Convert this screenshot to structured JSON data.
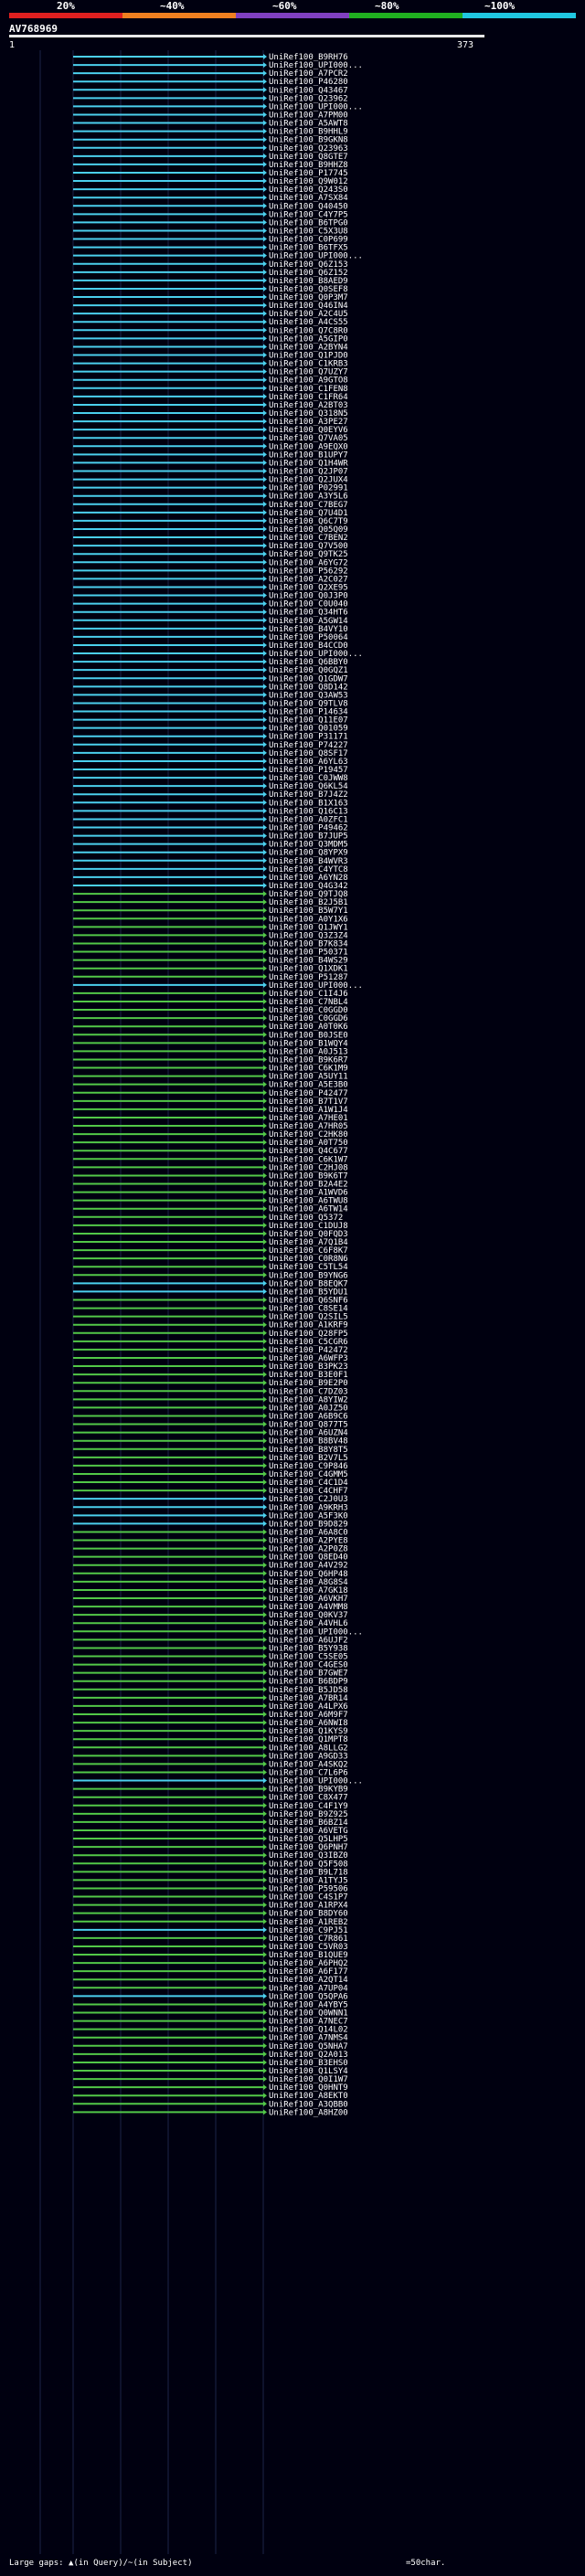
{
  "header": {
    "title": "AV768969",
    "scale_ticks": [
      "20%",
      "~40%",
      "~60%",
      "~80%",
      "~100%"
    ],
    "scale_colors": [
      "#e02020",
      "#f08020",
      "#8040c0",
      "#20b020",
      "#20c8e0"
    ],
    "query_start": "1",
    "query_end": "373"
  },
  "legend": {
    "large_gaps": "Large gaps: ▲(in Query)/~(in Subject)",
    "scale_note": "=50char."
  },
  "colors": {
    "cyan": "#4bd0ee",
    "green": "#52c848",
    "background": "#000010"
  },
  "hits": [
    {
      "label": "UniRef100_B9RH76",
      "color": "cyan"
    },
    {
      "label": "UniRef100_UPI000...",
      "color": "cyan"
    },
    {
      "label": "UniRef100_A7PCR2",
      "color": "cyan"
    },
    {
      "label": "UniRef100_P46280",
      "color": "cyan"
    },
    {
      "label": "UniRef100_Q43467",
      "color": "cyan"
    },
    {
      "label": "UniRef100_Q23962",
      "color": "cyan"
    },
    {
      "label": "UniRef100_UPI000...",
      "color": "cyan"
    },
    {
      "label": "UniRef100_A7PM00",
      "color": "cyan"
    },
    {
      "label": "UniRef100_A5AWT8",
      "color": "cyan"
    },
    {
      "label": "UniRef100_B9HHL9",
      "color": "cyan"
    },
    {
      "label": "UniRef100_B9GKN8",
      "color": "cyan"
    },
    {
      "label": "UniRef100_Q23963",
      "color": "cyan"
    },
    {
      "label": "UniRef100_Q8GTE7",
      "color": "cyan"
    },
    {
      "label": "UniRef100_B9HHZ8",
      "color": "cyan"
    },
    {
      "label": "UniRef100_P17745",
      "color": "cyan"
    },
    {
      "label": "UniRef100_Q9W012",
      "color": "cyan"
    },
    {
      "label": "UniRef100_Q243S0",
      "color": "cyan"
    },
    {
      "label": "UniRef100_A7SX84",
      "color": "cyan"
    },
    {
      "label": "UniRef100_Q40450",
      "color": "cyan"
    },
    {
      "label": "UniRef100_C4Y7P5",
      "color": "cyan"
    },
    {
      "label": "UniRef100_B6TPG0",
      "color": "cyan"
    },
    {
      "label": "UniRef100_C5X3U8",
      "color": "cyan"
    },
    {
      "label": "UniRef100_C0P699",
      "color": "cyan"
    },
    {
      "label": "UniRef100_B6TFX5",
      "color": "cyan"
    },
    {
      "label": "UniRef100_UPI000...",
      "color": "cyan"
    },
    {
      "label": "UniRef100_Q6Z153",
      "color": "cyan"
    },
    {
      "label": "UniRef100_Q6Z152",
      "color": "cyan"
    },
    {
      "label": "UniRef100_B8AED9",
      "color": "cyan"
    },
    {
      "label": "UniRef100_Q0SEF8",
      "color": "cyan"
    },
    {
      "label": "UniRef100_Q0P3M7",
      "color": "cyan"
    },
    {
      "label": "UniRef100_Q46IN4",
      "color": "cyan"
    },
    {
      "label": "UniRef100_A2C4U5",
      "color": "cyan"
    },
    {
      "label": "UniRef100_A4CS55",
      "color": "cyan"
    },
    {
      "label": "UniRef100_Q7C8R0",
      "color": "cyan"
    },
    {
      "label": "UniRef100_A5GIP0",
      "color": "cyan"
    },
    {
      "label": "UniRef100_A2BYN4",
      "color": "cyan"
    },
    {
      "label": "UniRef100_Q1PJD0",
      "color": "cyan"
    },
    {
      "label": "UniRef100_C1KRB3",
      "color": "cyan"
    },
    {
      "label": "UniRef100_Q7UZY7",
      "color": "cyan"
    },
    {
      "label": "UniRef100_A9GTO8",
      "color": "cyan"
    },
    {
      "label": "UniRef100_C1FEN8",
      "color": "cyan"
    },
    {
      "label": "UniRef100_C1FR64",
      "color": "cyan"
    },
    {
      "label": "UniRef100_A2BT03",
      "color": "cyan"
    },
    {
      "label": "UniRef100_Q318N5",
      "color": "cyan"
    },
    {
      "label": "UniRef100_A3PE27",
      "color": "cyan"
    },
    {
      "label": "UniRef100_Q0EYV6",
      "color": "cyan"
    },
    {
      "label": "UniRef100_Q7VA05",
      "color": "cyan"
    },
    {
      "label": "UniRef100_A9EQX0",
      "color": "cyan"
    },
    {
      "label": "UniRef100_B1UPY7",
      "color": "cyan"
    },
    {
      "label": "UniRef100_Q1H4WR",
      "color": "cyan"
    },
    {
      "label": "UniRef100_Q2JP07",
      "color": "cyan"
    },
    {
      "label": "UniRef100_Q2JUX4",
      "color": "cyan"
    },
    {
      "label": "UniRef100_P02991",
      "color": "cyan"
    },
    {
      "label": "UniRef100_A3Y5L6",
      "color": "cyan"
    },
    {
      "label": "UniRef100_C7BEG7",
      "color": "cyan"
    },
    {
      "label": "UniRef100_Q7U4D1",
      "color": "cyan"
    },
    {
      "label": "UniRef100_Q6C7T9",
      "color": "cyan"
    },
    {
      "label": "UniRef100_Q05Q09",
      "color": "cyan"
    },
    {
      "label": "UniRef100_C7BEN2",
      "color": "cyan"
    },
    {
      "label": "UniRef100_Q7V500",
      "color": "cyan"
    },
    {
      "label": "UniRef100_Q9TK25",
      "color": "cyan"
    },
    {
      "label": "UniRef100_A6YG72",
      "color": "cyan"
    },
    {
      "label": "UniRef100_P56292",
      "color": "cyan"
    },
    {
      "label": "UniRef100_A2C027",
      "color": "cyan"
    },
    {
      "label": "UniRef100_Q2XE95",
      "color": "cyan"
    },
    {
      "label": "UniRef100_Q0J3P0",
      "color": "cyan"
    },
    {
      "label": "UniRef100_C0U040",
      "color": "cyan"
    },
    {
      "label": "UniRef100_Q34HT6",
      "color": "cyan"
    },
    {
      "label": "UniRef100_A5GW14",
      "color": "cyan"
    },
    {
      "label": "UniRef100_B4VY10",
      "color": "cyan"
    },
    {
      "label": "UniRef100_P50064",
      "color": "cyan"
    },
    {
      "label": "UniRef100_B4CCD0",
      "color": "cyan"
    },
    {
      "label": "UniRef100_UPI000...",
      "color": "cyan"
    },
    {
      "label": "UniRef100_Q6BBY0",
      "color": "cyan"
    },
    {
      "label": "UniRef100_Q0GQZ1",
      "color": "cyan"
    },
    {
      "label": "UniRef100_Q1GDW7",
      "color": "cyan"
    },
    {
      "label": "UniRef100_Q8D142",
      "color": "cyan"
    },
    {
      "label": "UniRef100_Q3AW53",
      "color": "cyan"
    },
    {
      "label": "UniRef100_Q9TLV8",
      "color": "cyan"
    },
    {
      "label": "UniRef100_P14634",
      "color": "cyan"
    },
    {
      "label": "UniRef100_Q11E07",
      "color": "cyan"
    },
    {
      "label": "UniRef100_Q01059",
      "color": "cyan"
    },
    {
      "label": "UniRef100_P31171",
      "color": "cyan"
    },
    {
      "label": "UniRef100_P74227",
      "color": "cyan"
    },
    {
      "label": "UniRef100_Q8SF17",
      "color": "cyan"
    },
    {
      "label": "UniRef100_A6YL63",
      "color": "cyan"
    },
    {
      "label": "UniRef100_P19457",
      "color": "cyan"
    },
    {
      "label": "UniRef100_C0JWW8",
      "color": "cyan"
    },
    {
      "label": "UniRef100_Q6KL54",
      "color": "cyan"
    },
    {
      "label": "UniRef100_B7J4Z2",
      "color": "cyan"
    },
    {
      "label": "UniRef100_B1X163",
      "color": "cyan"
    },
    {
      "label": "UniRef100_Q16C13",
      "color": "cyan"
    },
    {
      "label": "UniRef100_A0ZFC1",
      "color": "cyan"
    },
    {
      "label": "UniRef100_P49462",
      "color": "cyan"
    },
    {
      "label": "UniRef100_B7JUP5",
      "color": "cyan"
    },
    {
      "label": "UniRef100_Q3MDM5",
      "color": "cyan"
    },
    {
      "label": "UniRef100_Q8YPX9",
      "color": "cyan"
    },
    {
      "label": "UniRef100_B4WVR3",
      "color": "cyan"
    },
    {
      "label": "UniRef100_C4YTC8",
      "color": "cyan"
    },
    {
      "label": "UniRef100_A6YN28",
      "color": "cyan"
    },
    {
      "label": "UniRef100_Q4G342",
      "color": "cyan"
    },
    {
      "label": "UniRef100_Q9TJQ8",
      "color": "green"
    },
    {
      "label": "UniRef100_B2J5B1",
      "color": "green"
    },
    {
      "label": "UniRef100_B5W7Y1",
      "color": "green"
    },
    {
      "label": "UniRef100_A0Y1X6",
      "color": "green"
    },
    {
      "label": "UniRef100_Q1JWY1",
      "color": "green"
    },
    {
      "label": "UniRef100_Q3Z3Z4",
      "color": "green"
    },
    {
      "label": "UniRef100_B7K834",
      "color": "green"
    },
    {
      "label": "UniRef100_P50371",
      "color": "green"
    },
    {
      "label": "UniRef100_B4WS29",
      "color": "green"
    },
    {
      "label": "UniRef100_Q1XDK1",
      "color": "green"
    },
    {
      "label": "UniRef100_P51287",
      "color": "green"
    },
    {
      "label": "UniRef100_UPI000...",
      "color": "cyan"
    },
    {
      "label": "UniRef100_C1I4J6",
      "color": "green"
    },
    {
      "label": "UniRef100_C7NBL4",
      "color": "green"
    },
    {
      "label": "UniRef100_C0GGD0",
      "color": "green"
    },
    {
      "label": "UniRef100_C0GGD6",
      "color": "green"
    },
    {
      "label": "UniRef100_A0T0K6",
      "color": "green"
    },
    {
      "label": "UniRef100_B0JSE0",
      "color": "green"
    },
    {
      "label": "UniRef100_B1WQY4",
      "color": "green"
    },
    {
      "label": "UniRef100_A0J513",
      "color": "green"
    },
    {
      "label": "UniRef100_B9K6R7",
      "color": "green"
    },
    {
      "label": "UniRef100_C6K1M9",
      "color": "green"
    },
    {
      "label": "UniRef100_A5UY11",
      "color": "green"
    },
    {
      "label": "UniRef100_A5E3B0",
      "color": "green"
    },
    {
      "label": "UniRef100_P42477",
      "color": "green"
    },
    {
      "label": "UniRef100_B7T1V7",
      "color": "green"
    },
    {
      "label": "UniRef100_A1W1J4",
      "color": "green"
    },
    {
      "label": "UniRef100_A7HE01",
      "color": "green"
    },
    {
      "label": "UniRef100_A7HR05",
      "color": "green"
    },
    {
      "label": "UniRef100_C2HK80",
      "color": "green"
    },
    {
      "label": "UniRef100_A0T750",
      "color": "green"
    },
    {
      "label": "UniRef100_Q4C677",
      "color": "green"
    },
    {
      "label": "UniRef100_C6K1W7",
      "color": "green"
    },
    {
      "label": "UniRef100_C2HJ08",
      "color": "green"
    },
    {
      "label": "UniRef100_B9K6T7",
      "color": "green"
    },
    {
      "label": "UniRef100_B2A4E2",
      "color": "green"
    },
    {
      "label": "UniRef100_A1WVD6",
      "color": "green"
    },
    {
      "label": "UniRef100_A6TWU8",
      "color": "green"
    },
    {
      "label": "UniRef100_A6TW14",
      "color": "green"
    },
    {
      "label": "UniRef100_Q5372",
      "color": "green"
    },
    {
      "label": "UniRef100_C1DUJ8",
      "color": "green"
    },
    {
      "label": "UniRef100_Q0FQD3",
      "color": "green"
    },
    {
      "label": "UniRef100_A7Q1B4",
      "color": "green"
    },
    {
      "label": "UniRef100_C6F8K7",
      "color": "green"
    },
    {
      "label": "UniRef100_C0R8N6",
      "color": "green"
    },
    {
      "label": "UniRef100_C5TL54",
      "color": "green"
    },
    {
      "label": "UniRef100_B9YNG6",
      "color": "green"
    },
    {
      "label": "UniRef100_B8EQK7",
      "color": "cyan"
    },
    {
      "label": "UniRef100_B5YDU1",
      "color": "cyan"
    },
    {
      "label": "UniRef100_Q6SNF6",
      "color": "green"
    },
    {
      "label": "UniRef100_C8SE14",
      "color": "green"
    },
    {
      "label": "UniRef100_Q2SIL5",
      "color": "green"
    },
    {
      "label": "UniRef100_A1KRF9",
      "color": "green"
    },
    {
      "label": "UniRef100_Q28FP5",
      "color": "green"
    },
    {
      "label": "UniRef100_C5CGR6",
      "color": "green"
    },
    {
      "label": "UniRef100_P42472",
      "color": "green"
    },
    {
      "label": "UniRef100_A6WFP3",
      "color": "green"
    },
    {
      "label": "UniRef100_B3PK23",
      "color": "green"
    },
    {
      "label": "UniRef100_B3E0F1",
      "color": "green"
    },
    {
      "label": "UniRef100_B9E2P0",
      "color": "green"
    },
    {
      "label": "UniRef100_C7DZ03",
      "color": "green"
    },
    {
      "label": "UniRef100_A8YIW2",
      "color": "green"
    },
    {
      "label": "UniRef100_A0JZ50",
      "color": "green"
    },
    {
      "label": "UniRef100_A6B9C6",
      "color": "green"
    },
    {
      "label": "UniRef100_Q877T5",
      "color": "green"
    },
    {
      "label": "UniRef100_A6UZN4",
      "color": "green"
    },
    {
      "label": "UniRef100_B8BV48",
      "color": "green"
    },
    {
      "label": "UniRef100_B8Y8T5",
      "color": "green"
    },
    {
      "label": "UniRef100_B2V7L5",
      "color": "green"
    },
    {
      "label": "UniRef100_C9P846",
      "color": "green"
    },
    {
      "label": "UniRef100_C4GMM5",
      "color": "green"
    },
    {
      "label": "UniRef100_C4C1D4",
      "color": "green"
    },
    {
      "label": "UniRef100_C4CHF7",
      "color": "green"
    },
    {
      "label": "UniRef100_C2J0U3",
      "color": "cyan"
    },
    {
      "label": "UniRef100_A9KRH3",
      "color": "cyan"
    },
    {
      "label": "UniRef100_A5F3K0",
      "color": "cyan"
    },
    {
      "label": "UniRef100_B9D829",
      "color": "cyan"
    },
    {
      "label": "UniRef100_A6A8C0",
      "color": "green"
    },
    {
      "label": "UniRef100_A2PYE8",
      "color": "green"
    },
    {
      "label": "UniRef100_A2P0Z8",
      "color": "green"
    },
    {
      "label": "UniRef100_Q8ED40",
      "color": "green"
    },
    {
      "label": "UniRef100_A4V292",
      "color": "green"
    },
    {
      "label": "UniRef100_Q6HP48",
      "color": "green"
    },
    {
      "label": "UniRef100_A8G8S4",
      "color": "green"
    },
    {
      "label": "UniRef100_A7GK18",
      "color": "green"
    },
    {
      "label": "UniRef100_A6VKH7",
      "color": "green"
    },
    {
      "label": "UniRef100_A4VMM8",
      "color": "green"
    },
    {
      "label": "UniRef100_Q0KV37",
      "color": "green"
    },
    {
      "label": "UniRef100_A4VHL6",
      "color": "green"
    },
    {
      "label": "UniRef100_UPI000...",
      "color": "green"
    },
    {
      "label": "UniRef100_A6UJF2",
      "color": "green"
    },
    {
      "label": "UniRef100_B5Y938",
      "color": "green"
    },
    {
      "label": "UniRef100_C5SE05",
      "color": "green"
    },
    {
      "label": "UniRef100_C4GES0",
      "color": "green"
    },
    {
      "label": "UniRef100_B7GWE7",
      "color": "green"
    },
    {
      "label": "UniRef100_B6BDP9",
      "color": "green"
    },
    {
      "label": "UniRef100_B5JD58",
      "color": "green"
    },
    {
      "label": "UniRef100_A7BR14",
      "color": "green"
    },
    {
      "label": "UniRef100_A4LPX6",
      "color": "green"
    },
    {
      "label": "UniRef100_A6M9F7",
      "color": "green"
    },
    {
      "label": "UniRef100_A6NWI8",
      "color": "green"
    },
    {
      "label": "UniRef100_Q1KYS9",
      "color": "green"
    },
    {
      "label": "UniRef100_Q1MPT8",
      "color": "green"
    },
    {
      "label": "UniRef100_A8LLG2",
      "color": "green"
    },
    {
      "label": "UniRef100_A9GD33",
      "color": "green"
    },
    {
      "label": "UniRef100_A4SKQ2",
      "color": "green"
    },
    {
      "label": "UniRef100_C7L6P6",
      "color": "green"
    },
    {
      "label": "UniRef100_UPI000...",
      "color": "cyan"
    },
    {
      "label": "UniRef100_B9KYB9",
      "color": "green"
    },
    {
      "label": "UniRef100_C8X477",
      "color": "green"
    },
    {
      "label": "UniRef100_C4F1Y9",
      "color": "green"
    },
    {
      "label": "UniRef100_B9Z925",
      "color": "green"
    },
    {
      "label": "UniRef100_B6BZ14",
      "color": "green"
    },
    {
      "label": "UniRef100_A6VETG",
      "color": "green"
    },
    {
      "label": "UniRef100_Q5LHP5",
      "color": "green"
    },
    {
      "label": "UniRef100_Q6PNH7",
      "color": "green"
    },
    {
      "label": "UniRef100_Q3IBZ0",
      "color": "green"
    },
    {
      "label": "UniRef100_Q5F508",
      "color": "green"
    },
    {
      "label": "UniRef100_B9L718",
      "color": "green"
    },
    {
      "label": "UniRef100_A1TYJ5",
      "color": "green"
    },
    {
      "label": "UniRef100_P59506",
      "color": "green"
    },
    {
      "label": "UniRef100_C4S1P7",
      "color": "green"
    },
    {
      "label": "UniRef100_A1RPX4",
      "color": "green"
    },
    {
      "label": "UniRef100_B8DY60",
      "color": "green"
    },
    {
      "label": "UniRef100_A1REB2",
      "color": "green"
    },
    {
      "label": "UniRef100_C9PJ51",
      "color": "cyan"
    },
    {
      "label": "UniRef100_C7R861",
      "color": "green"
    },
    {
      "label": "UniRef100_C5VR03",
      "color": "green"
    },
    {
      "label": "UniRef100_B1QUE9",
      "green": "",
      "color": "green"
    },
    {
      "label": "UniRef100_A6PHQ2",
      "color": "green"
    },
    {
      "label": "UniRef100_A6F177",
      "color": "green"
    },
    {
      "label": "UniRef100_A2QT14",
      "color": "green"
    },
    {
      "label": "UniRef100_A7UP04",
      "color": "green"
    },
    {
      "label": "UniRef100_Q5QPA6",
      "color": "cyan"
    },
    {
      "label": "UniRef100_A4YBY5",
      "color": "green"
    },
    {
      "label": "UniRef100_Q0WNN1",
      "color": "green"
    },
    {
      "label": "UniRef100_A7NEC7",
      "color": "green"
    },
    {
      "label": "UniRef100_Q14L02",
      "color": "green"
    },
    {
      "label": "UniRef100_A7NMS4",
      "color": "green"
    },
    {
      "label": "UniRef100_Q5NHA7",
      "color": "green"
    },
    {
      "label": "UniRef100_Q2A013",
      "color": "green"
    },
    {
      "label": "UniRef100_B3EHS0",
      "color": "green"
    },
    {
      "label": "UniRef100_Q1LSY4",
      "color": "green"
    },
    {
      "label": "UniRef100_Q0I1W7",
      "color": "green"
    },
    {
      "label": "UniRef100_Q0HNT9",
      "color": "green"
    },
    {
      "label": "UniRef100_A8EKT0",
      "color": "green"
    },
    {
      "label": "UniRef100_A3QBB0",
      "color": "green"
    },
    {
      "label": "UniRef100_A8HZ00",
      "color": "green"
    }
  ]
}
